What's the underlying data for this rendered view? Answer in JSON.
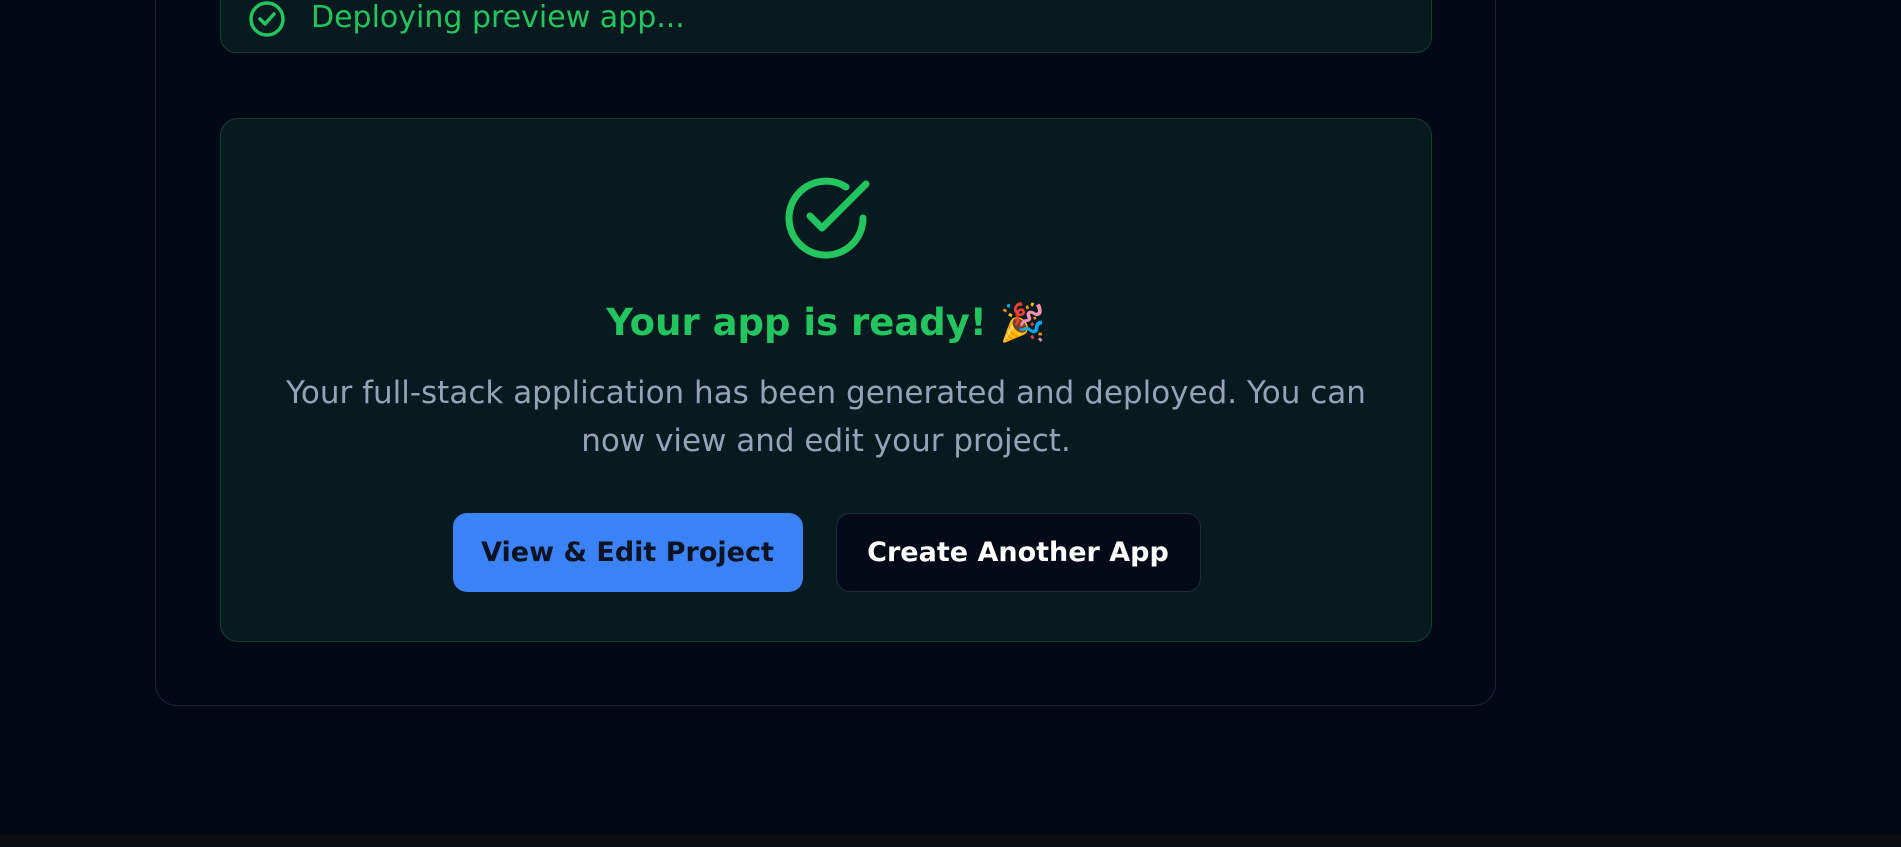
{
  "progress_step": {
    "label": "Deploying preview app...",
    "icon": "check-circle-icon",
    "status_color": "#22c55e"
  },
  "success": {
    "icon": "check-circle-icon",
    "title": "Your app is ready! 🎉",
    "description": "Your full-stack application has been generated and deployed. You can now view and edit your project.",
    "accent_color": "#22c55e"
  },
  "actions": {
    "primary_label": "View & Edit Project",
    "secondary_label": "Create Another App",
    "primary_color": "#3b82f6"
  }
}
